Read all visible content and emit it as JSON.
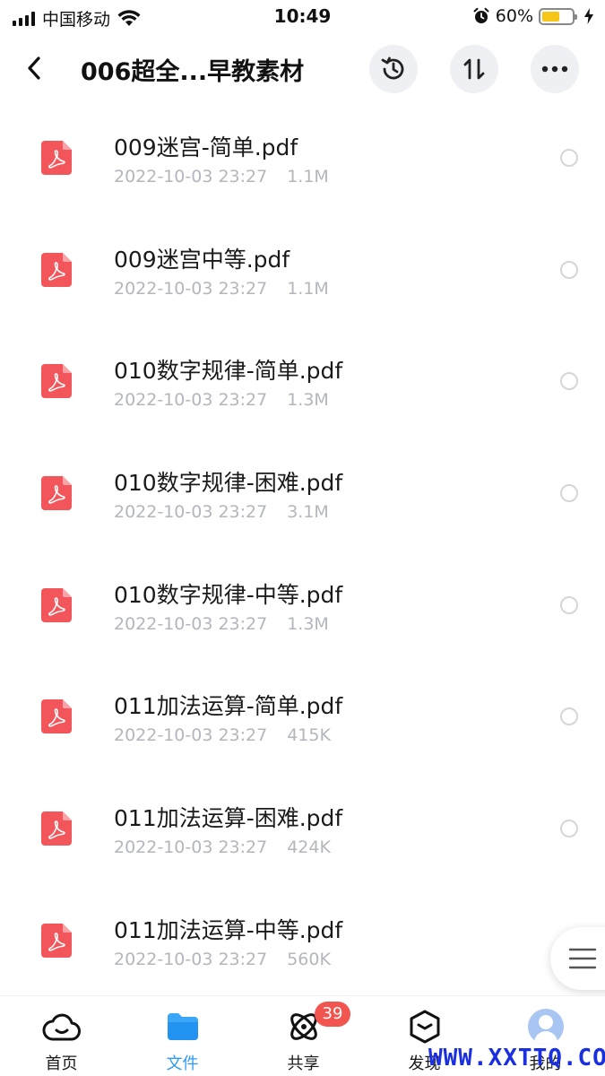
{
  "status_bar": {
    "carrier": "中国移动",
    "time": "10:49",
    "battery_percent_text": "60%",
    "battery_level": 0.6
  },
  "nav": {
    "title": "006超全...早教素材"
  },
  "files": [
    {
      "name": "009迷宫-简单.pdf",
      "date": "2022-10-03 23:27",
      "size": "1.1M"
    },
    {
      "name": "009迷宫中等.pdf",
      "date": "2022-10-03 23:27",
      "size": "1.1M"
    },
    {
      "name": "010数字规律-简单.pdf",
      "date": "2022-10-03 23:27",
      "size": "1.3M"
    },
    {
      "name": "010数字规律-困难.pdf",
      "date": "2022-10-03 23:27",
      "size": "3.1M"
    },
    {
      "name": "010数字规律-中等.pdf",
      "date": "2022-10-03 23:27",
      "size": "1.3M"
    },
    {
      "name": "011加法运算-简单.pdf",
      "date": "2022-10-03 23:27",
      "size": "415K"
    },
    {
      "name": "011加法运算-困难.pdf",
      "date": "2022-10-03 23:27",
      "size": "424K"
    },
    {
      "name": "011加法运算-中等.pdf",
      "date": "2022-10-03 23:27",
      "size": "560K"
    }
  ],
  "tabs": {
    "home": "首页",
    "files": "文件",
    "share": "共享",
    "share_badge": "39",
    "discover": "发现",
    "mine": "我的"
  },
  "colors": {
    "accent": "#2f9bf5",
    "pdf_red": "#f2555a",
    "badge_red": "#f2554f"
  },
  "watermark": "WWW.XXTTQ.COM"
}
